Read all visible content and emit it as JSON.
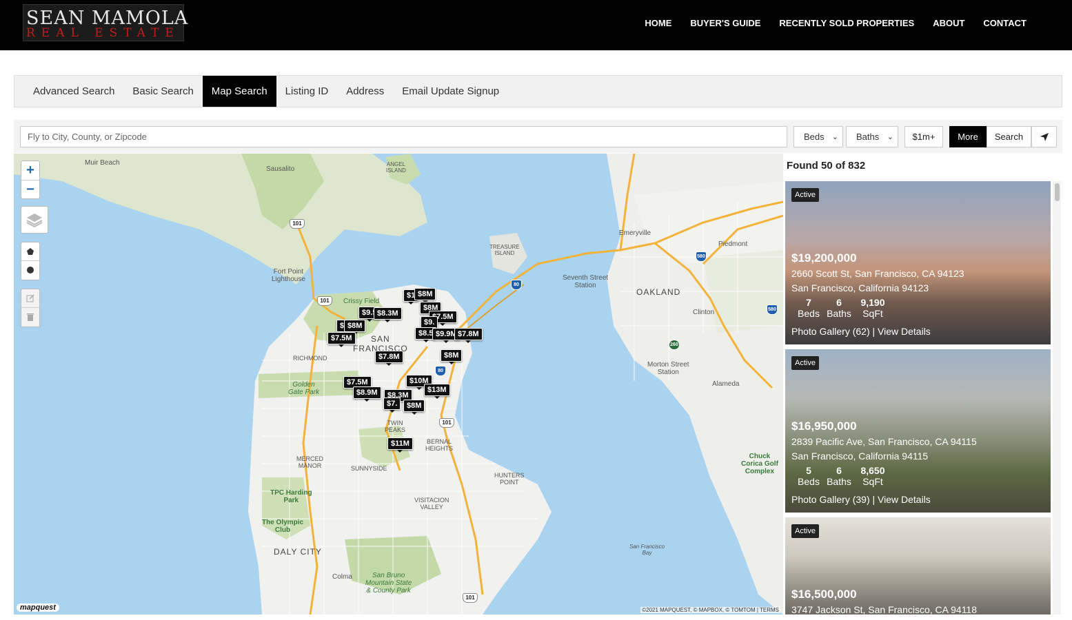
{
  "header": {
    "logo_line1": "SEAN MAMOLA",
    "logo_line2": "REAL ESTATE",
    "nav": [
      "HOME",
      "BUYER'S GUIDE",
      "RECENTLY SOLD PROPERTIES",
      "ABOUT",
      "CONTACT"
    ]
  },
  "tabs": [
    {
      "label": "Advanced Search",
      "active": false
    },
    {
      "label": "Basic Search",
      "active": false
    },
    {
      "label": "Map Search",
      "active": true
    },
    {
      "label": "Listing ID",
      "active": false
    },
    {
      "label": "Address",
      "active": false
    },
    {
      "label": "Email Update Signup",
      "active": false
    }
  ],
  "search": {
    "placeholder": "Fly to City, County, or Zipcode",
    "beds_label": "Beds",
    "baths_label": "Baths",
    "price_label": "$1m+",
    "more_label": "More",
    "search_label": "Search"
  },
  "map": {
    "labels": {
      "muir_beach": "Muir Beach",
      "sausalito": "Sausalito",
      "angel_island": "ANGEL\nISLAND",
      "treasure_island": "TREASURE\nISLAND",
      "emeryville": "Emeryville",
      "piedmont": "Piedmont",
      "fort_point": "Fort Point\nLighthouse",
      "seventh_street": "Seventh Street\nStation",
      "oakland": "OAKLAND",
      "clinton": "Clinton",
      "crissy_field": "Crissy Field",
      "san_francisco": "SAN\nFRANCISCO",
      "richmond": "RICHMOND",
      "golden_gate_park": "Golden\nGate Park",
      "morton_street": "Morton Street\nStation",
      "alameda": "Alameda",
      "twin_peaks": "TWIN\nPEAKS",
      "bernal_heights": "BERNAL\nHEIGHTS",
      "merced_manor": "MERCED\nMANOR",
      "sunnyside": "SUNNYSIDE",
      "hunters_point": "HUNTERS\nPOINT",
      "chuck_corica": "Chuck\nCorica Golf\nComplex",
      "tpc_harding": "TPC Harding\nPark",
      "olympic_club": "The Olympic\nClub",
      "visitacion_valley": "VISITACION\nVALLEY",
      "daly_city": "DALY CITY",
      "sf_bay": "San Francisco\nBay",
      "colma": "Colma",
      "san_bruno": "San Bruno\nMountain State\n& County Park"
    },
    "markers": [
      "$1",
      "$8M",
      "$9.5",
      "$8.3M",
      "$8M",
      "$7.5M",
      "$9.",
      "$1",
      "$8M",
      "$7.5M",
      "$8.5",
      "$9.9M",
      "$7.8M",
      "$7.8M",
      "$8M",
      "$7.5M",
      "$10M",
      "$8.9M",
      "$8.3M",
      "$13M",
      "$7.",
      "$8M",
      "$11M"
    ],
    "shields": [
      "101",
      "101",
      "80",
      "580",
      "580",
      "80",
      "101",
      "101",
      "260"
    ],
    "attribution": "©2021 MAPQUEST, © MAPBOX, © TOMTOM | TERMS",
    "provider_logo": "mapquest"
  },
  "results": {
    "found_text": "Found 50 of 832",
    "listings": [
      {
        "status": "Active",
        "price": "$19,200,000",
        "address": "2660 Scott St, San Francisco, CA 94123",
        "city_line": "San Francisco, California 94123",
        "beds": "7",
        "baths": "6",
        "sqft": "9,190",
        "beds_label": "Beds",
        "baths_label": "Baths",
        "sqft_label": "SqFt",
        "gallery": "Photo Gallery (62)",
        "details": "View Details"
      },
      {
        "status": "Active",
        "price": "$16,950,000",
        "address": "2839 Pacific Ave, San Francisco, CA 94115",
        "city_line": "San Francisco, California 94115",
        "beds": "5",
        "baths": "6",
        "sqft": "8,650",
        "beds_label": "Beds",
        "baths_label": "Baths",
        "sqft_label": "SqFt",
        "gallery": "Photo Gallery (39)",
        "details": "View Details"
      },
      {
        "status": "Active",
        "price": "$16,500,000",
        "address": "3747 Jackson St, San Francisco, CA 94118"
      }
    ],
    "separator": "|"
  }
}
